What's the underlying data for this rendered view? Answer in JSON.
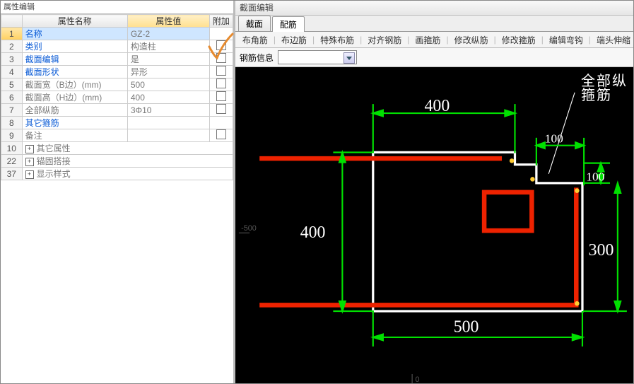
{
  "left_title": "属性编辑",
  "columns": {
    "index": "",
    "name": "属性名称",
    "value": "属性值",
    "add": "附加"
  },
  "rows": [
    {
      "idx": "1",
      "name": "名称",
      "value": "GZ-2",
      "blue": true,
      "add_chk": false,
      "sel": true
    },
    {
      "idx": "2",
      "name": "类别",
      "value": "构造柱",
      "blue": true,
      "add_chk": true
    },
    {
      "idx": "3",
      "name": "截面编辑",
      "value": "是",
      "blue": true,
      "add_chk": true
    },
    {
      "idx": "4",
      "name": "截面形状",
      "value": "异形",
      "blue": true,
      "add_chk": true
    },
    {
      "idx": "5",
      "name": "截面宽（B边）(mm)",
      "value": "500",
      "blue": false,
      "add_chk": true
    },
    {
      "idx": "6",
      "name": "截面高（H边）(mm)",
      "value": "400",
      "blue": false,
      "add_chk": true
    },
    {
      "idx": "7",
      "name": "全部纵筋",
      "value": "3Φ10",
      "blue": false,
      "add_chk": true
    },
    {
      "idx": "8",
      "name": "其它箍筋",
      "value": "",
      "blue": true,
      "add_chk": false
    },
    {
      "idx": "9",
      "name": "备注",
      "value": "",
      "blue": false,
      "add_chk": true
    }
  ],
  "group_rows": [
    {
      "idx": "10",
      "name": "其它属性"
    },
    {
      "idx": "22",
      "name": "锚固搭接"
    },
    {
      "idx": "37",
      "name": "显示样式"
    }
  ],
  "right_title": "截面编辑",
  "tabs": [
    {
      "label": "截面",
      "active": false
    },
    {
      "label": "配筋",
      "active": true
    }
  ],
  "toolbar_buttons": [
    "布角筋",
    "布边筋",
    "特殊布筋",
    "对齐钢筋",
    "画箍筋",
    "修改纵筋",
    "修改箍筋",
    "编辑弯钩",
    "端头伸缩"
  ],
  "info_label": "钢筋信息",
  "dims": {
    "top": "400",
    "left": "400",
    "bottom": "500",
    "right": "300",
    "notch_w": "100",
    "notch_h": "100",
    "scale_left": "-500",
    "scale_bottom": "0"
  },
  "leader_lines": [
    "全部纵",
    "箍筋"
  ]
}
